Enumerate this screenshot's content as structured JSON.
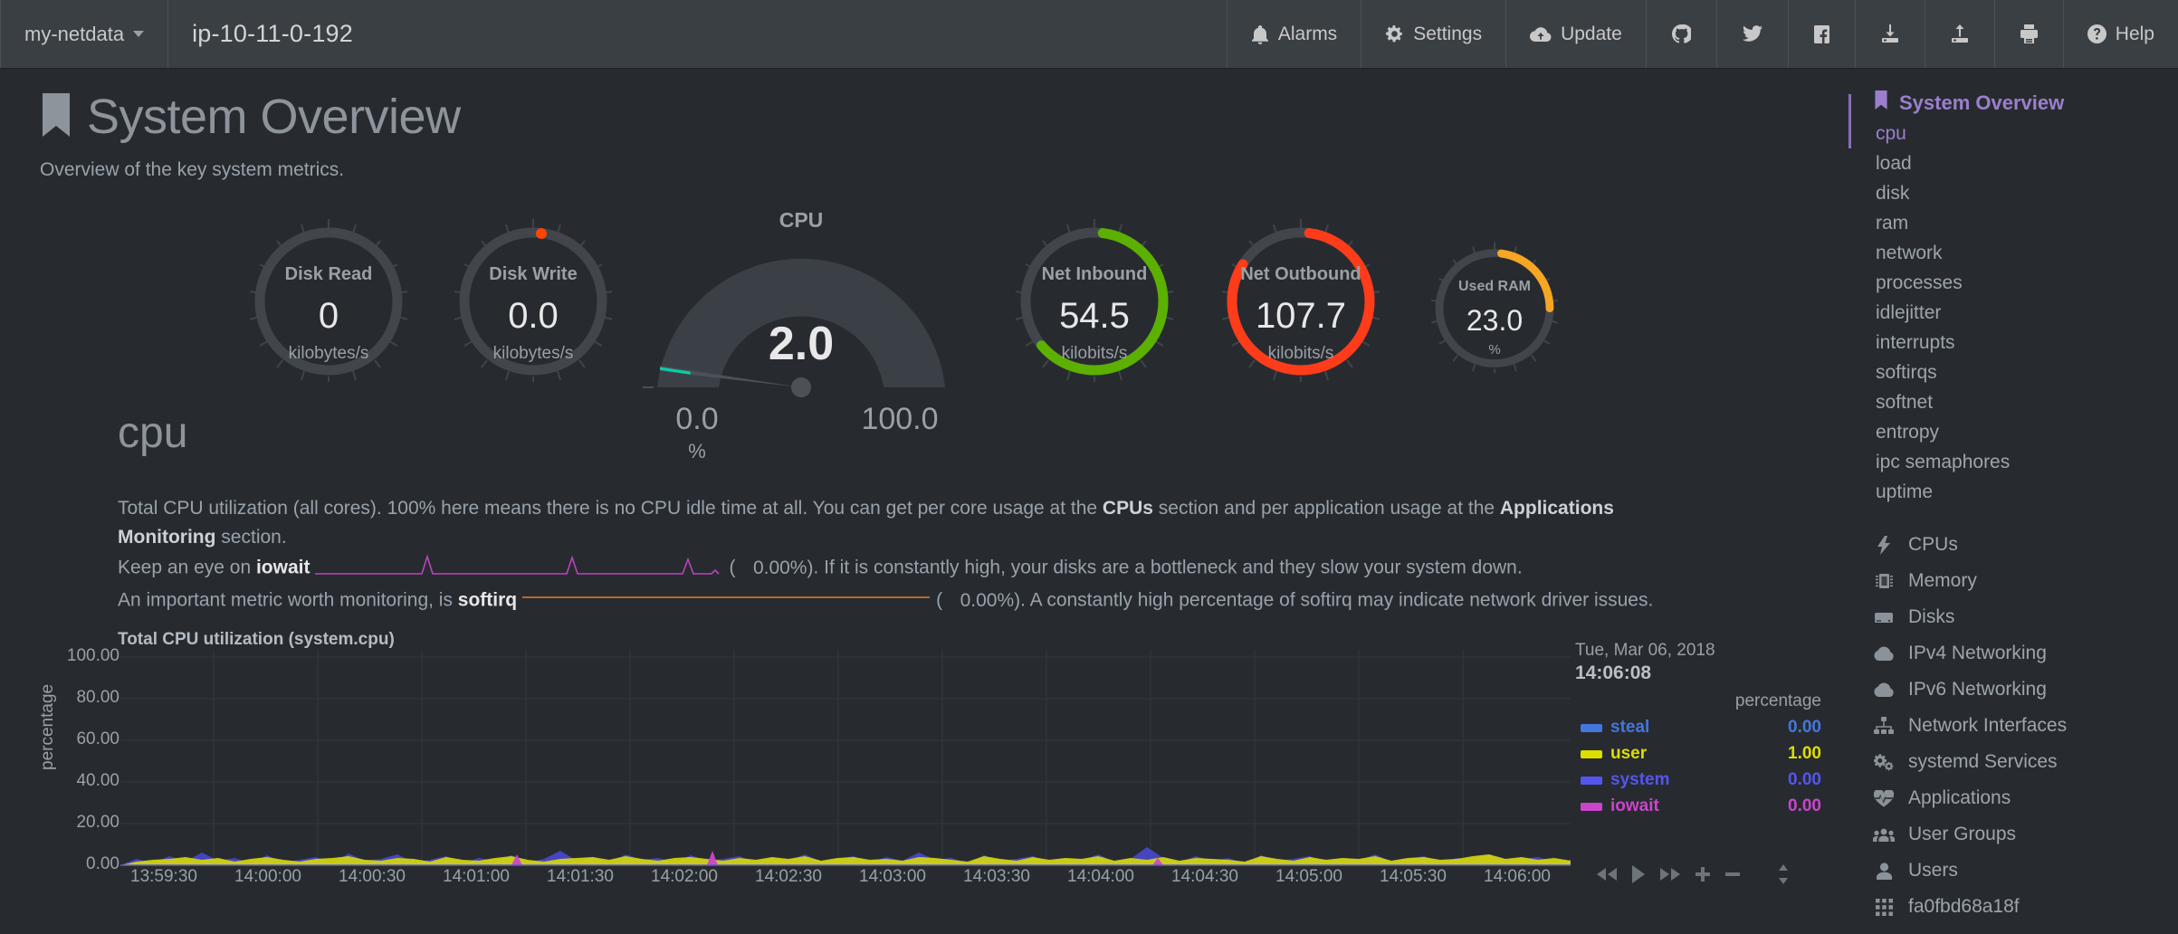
{
  "navbar": {
    "brand": "my-netdata",
    "hostname": "ip-10-11-0-192",
    "items": [
      {
        "label": "Alarms",
        "icon": "bell-icon"
      },
      {
        "label": "Settings",
        "icon": "gear-icon"
      },
      {
        "label": "Update",
        "icon": "cloud-download-icon"
      },
      {
        "label": "",
        "icon": "github-icon"
      },
      {
        "label": "",
        "icon": "twitter-icon"
      },
      {
        "label": "",
        "icon": "facebook-icon"
      },
      {
        "label": "",
        "icon": "import-icon"
      },
      {
        "label": "",
        "icon": "export-icon"
      },
      {
        "label": "",
        "icon": "print-icon"
      },
      {
        "label": "Help",
        "icon": "question-circle-icon"
      }
    ]
  },
  "header": {
    "icon": "bookmark-icon",
    "title": "System Overview",
    "subtitle": "Overview of the key system metrics."
  },
  "gauges": [
    {
      "label": "Disk Read",
      "value": "0",
      "unit": "kilobytes/s",
      "arc_color": "#4a5055",
      "arc_pct": 0
    },
    {
      "label": "Disk Write",
      "value": "0.0",
      "unit": "kilobytes/s",
      "arc_color": "#ff4500",
      "arc_pct": 0.5
    },
    {
      "label": "Net Inbound",
      "value": "54.5",
      "unit": "kilobits/s",
      "arc_color": "#5bb000",
      "arc_pct": 62
    },
    {
      "label": "Net Outbound",
      "value": "107.7",
      "unit": "kilobits/s",
      "arc_color": "#ff3c19",
      "arc_pct": 82
    },
    {
      "label": "Used RAM",
      "value": "23.0",
      "unit": "%",
      "arc_color": "#f5a623",
      "arc_pct": 23
    }
  ],
  "cpu_gauge": {
    "title": "CPU",
    "value": "2.0",
    "min": "0.0",
    "max": "100.0",
    "unit": "%",
    "needle_pct": 2.0,
    "needle_color": "#00d4aa"
  },
  "cpu_section": {
    "heading": "cpu",
    "p1_a": "Total CPU utilization (all cores). 100% here means there is no CPU idle time at all. You can get per core usage at the ",
    "p1_cpus": "CPUs",
    "p1_b": " section and per application usage at the ",
    "p1_apps": "Applications Monitoring",
    "p1_c": " section.",
    "p2_a": "Keep an eye on ",
    "p2_metric": "iowait",
    "p2_open": "(",
    "p2_pct": "0.00%)",
    "p2_b": ". If it is constantly high, your disks are a bottleneck and they slow your system down.",
    "p3_a": "An important metric worth monitoring, is ",
    "p3_metric": "softirq",
    "p3_open": "(",
    "p3_pct": "0.00%)",
    "p3_b": ". A constantly high percentage of softirq may indicate network driver issues.",
    "iowait_spark_color": "#bb44bb",
    "softirq_spark_color": "#e08030"
  },
  "chart_data": {
    "type": "area",
    "title": "Total CPU utilization (system.cpu)",
    "ylabel": "percentage",
    "xlabel": "",
    "ylim": [
      0,
      100
    ],
    "yticks": [
      "100.00",
      "80.00",
      "60.00",
      "40.00",
      "20.00",
      "0.00"
    ],
    "grid": true,
    "legend_position": "right",
    "x": [
      "13:59:30",
      "14:00:00",
      "14:00:30",
      "14:01:00",
      "14:01:30",
      "14:02:00",
      "14:02:30",
      "14:03:00",
      "14:03:30",
      "14:04:00",
      "14:04:30",
      "14:05:00",
      "14:05:30",
      "14:06:00"
    ],
    "series": [
      {
        "name": "steal",
        "color": "#4477dd",
        "value": "0.00",
        "values": [
          0,
          0,
          0,
          0,
          0,
          0,
          0,
          0,
          0,
          0,
          0,
          0,
          0,
          0
        ]
      },
      {
        "name": "user",
        "color": "#dddd00",
        "value": "1.00",
        "values": [
          1.2,
          0.9,
          1.5,
          1.0,
          2.0,
          1.4,
          1.1,
          1.8,
          1.3,
          1.0,
          1.6,
          1.2,
          1.0,
          1.0
        ]
      },
      {
        "name": "system",
        "color": "#5555ee",
        "value": "0.00",
        "values": [
          0.8,
          0.6,
          1.0,
          0.7,
          1.4,
          0.9,
          0.7,
          1.2,
          0.8,
          0.6,
          1.0,
          0.8,
          0.7,
          0.0
        ]
      },
      {
        "name": "iowait",
        "color": "#cc44cc",
        "value": "0.00",
        "values": [
          0,
          0,
          0,
          0,
          0.3,
          0,
          0,
          0.4,
          0,
          0,
          0.2,
          0,
          0,
          0
        ]
      }
    ],
    "tooltip": {
      "date": "Tue, Mar 06, 2018",
      "time": "14:06:08",
      "units_header": "percentage"
    }
  },
  "chart_controls": [
    {
      "name": "rewind-button",
      "icon": "backward-icon"
    },
    {
      "name": "play-button",
      "icon": "play-icon"
    },
    {
      "name": "forward-button",
      "icon": "forward-icon"
    },
    {
      "name": "zoom-in-button",
      "icon": "plus-icon"
    },
    {
      "name": "zoom-out-button",
      "icon": "minus-icon"
    },
    {
      "name": "resize-handle",
      "icon": "resize-vertical-icon"
    }
  ],
  "sidebar": {
    "head": {
      "label": "System Overview",
      "icon": "bookmark-icon"
    },
    "sub_items": [
      {
        "label": "cpu",
        "active": true
      },
      {
        "label": "load",
        "active": false
      },
      {
        "label": "disk",
        "active": false
      },
      {
        "label": "ram",
        "active": false
      },
      {
        "label": "network",
        "active": false
      },
      {
        "label": "processes",
        "active": false
      },
      {
        "label": "idlejitter",
        "active": false
      },
      {
        "label": "interrupts",
        "active": false
      },
      {
        "label": "softirqs",
        "active": false
      },
      {
        "label": "softnet",
        "active": false
      },
      {
        "label": "entropy",
        "active": false
      },
      {
        "label": "ipc semaphores",
        "active": false
      },
      {
        "label": "uptime",
        "active": false
      }
    ],
    "items": [
      {
        "label": "CPUs",
        "icon": "bolt-icon"
      },
      {
        "label": "Memory",
        "icon": "memory-chip-icon"
      },
      {
        "label": "Disks",
        "icon": "hdd-icon"
      },
      {
        "label": "IPv4 Networking",
        "icon": "cloud-icon"
      },
      {
        "label": "IPv6 Networking",
        "icon": "cloud-icon"
      },
      {
        "label": "Network Interfaces",
        "icon": "sitemap-icon"
      },
      {
        "label": "systemd Services",
        "icon": "cogs-icon"
      },
      {
        "label": "Applications",
        "icon": "heartbeat-icon"
      },
      {
        "label": "User Groups",
        "icon": "users-icon"
      },
      {
        "label": "Users",
        "icon": "user-icon"
      },
      {
        "label": "fa0fbd68a18f",
        "icon": "th-grid-icon"
      }
    ]
  },
  "colors": {
    "background": "#272b30",
    "navbar": "#3a3f44",
    "accent_purple": "#9b7fcc",
    "text_muted": "#9aa0a6"
  }
}
